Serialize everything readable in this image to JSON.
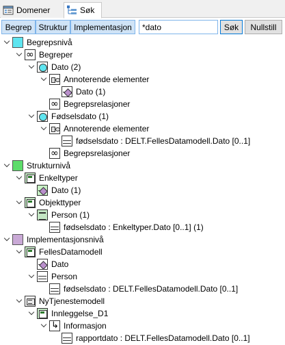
{
  "tabs": [
    {
      "label": "Domener",
      "icon": "folder-icon",
      "active": false
    },
    {
      "label": "Søk",
      "icon": "tree-icon",
      "active": true
    }
  ],
  "toolbar": {
    "segments": [
      "Begrep",
      "Struktur",
      "Implementasjon"
    ],
    "search_value": "*dato",
    "search_button": "Søk",
    "reset_button": "Nullstill"
  },
  "tree": [
    {
      "label": "Begrepsnivå",
      "icon": "cyan-square-icon",
      "level": 0,
      "expanded": true
    },
    {
      "label": "Begreper",
      "icon": "concept-group-icon",
      "level": 1,
      "expanded": true
    },
    {
      "label": "Dato (2)",
      "icon": "concept-icon",
      "level": 2,
      "expanded": true
    },
    {
      "label": "Annoterende elementer",
      "icon": "relation-icon",
      "level": 3,
      "expanded": true
    },
    {
      "label": "Dato (1)",
      "icon": "datatype-icon",
      "level": 4,
      "expanded": null
    },
    {
      "label": "Begrepsrelasjoner",
      "icon": "chain-icon",
      "level": 3,
      "expanded": null
    },
    {
      "label": "Fødselsdato (1)",
      "icon": "concept-icon",
      "level": 2,
      "expanded": true
    },
    {
      "label": "Annoterende elementer",
      "icon": "relation-icon",
      "level": 3,
      "expanded": true
    },
    {
      "label": "fødselsdato : DELT.FellesDatamodell.Dato [0..1]",
      "icon": "attribute-icon",
      "level": 4,
      "expanded": null
    },
    {
      "label": "Begrepsrelasjoner",
      "icon": "chain-icon",
      "level": 3,
      "expanded": null
    },
    {
      "label": "Strukturnivå",
      "icon": "green-square-icon",
      "level": 0,
      "expanded": true
    },
    {
      "label": "Enkeltyper",
      "icon": "type-group-icon",
      "level": 1,
      "expanded": true
    },
    {
      "label": "Dato (1)",
      "icon": "datatype-green-icon",
      "level": 2,
      "expanded": null
    },
    {
      "label": "Objekttyper",
      "icon": "type-group-icon",
      "level": 1,
      "expanded": true
    },
    {
      "label": "Person (1)",
      "icon": "object-icon",
      "level": 2,
      "expanded": true
    },
    {
      "label": "fødselsdato : Enkeltyper.Dato [0..1] (1)",
      "icon": "attribute-icon",
      "level": 3,
      "expanded": null
    },
    {
      "label": "Implementasjonsnivå",
      "icon": "purple-square-icon",
      "level": 0,
      "expanded": true
    },
    {
      "label": "FellesDatamodell",
      "icon": "type-group-icon",
      "level": 1,
      "expanded": true
    },
    {
      "label": "Dato",
      "icon": "datatype-icon",
      "level": 2,
      "expanded": null
    },
    {
      "label": "Person",
      "icon": "object-plain-icon",
      "level": 2,
      "expanded": true
    },
    {
      "label": "fødselsdato : DELT.FellesDatamodell.Dato [0..1]",
      "icon": "attribute-icon",
      "level": 3,
      "expanded": null
    },
    {
      "label": "NyTjenestemodell",
      "icon": "message-group-icon",
      "level": 1,
      "expanded": true
    },
    {
      "label": "Innleggelse_D1",
      "icon": "type-group-icon",
      "level": 2,
      "expanded": true
    },
    {
      "label": "Informasjon",
      "icon": "arrow-icon",
      "level": 3,
      "expanded": true
    },
    {
      "label": "rapportdato : DELT.FellesDatamodell.Dato [0..1]",
      "icon": "attribute-icon",
      "level": 4,
      "expanded": null
    }
  ]
}
